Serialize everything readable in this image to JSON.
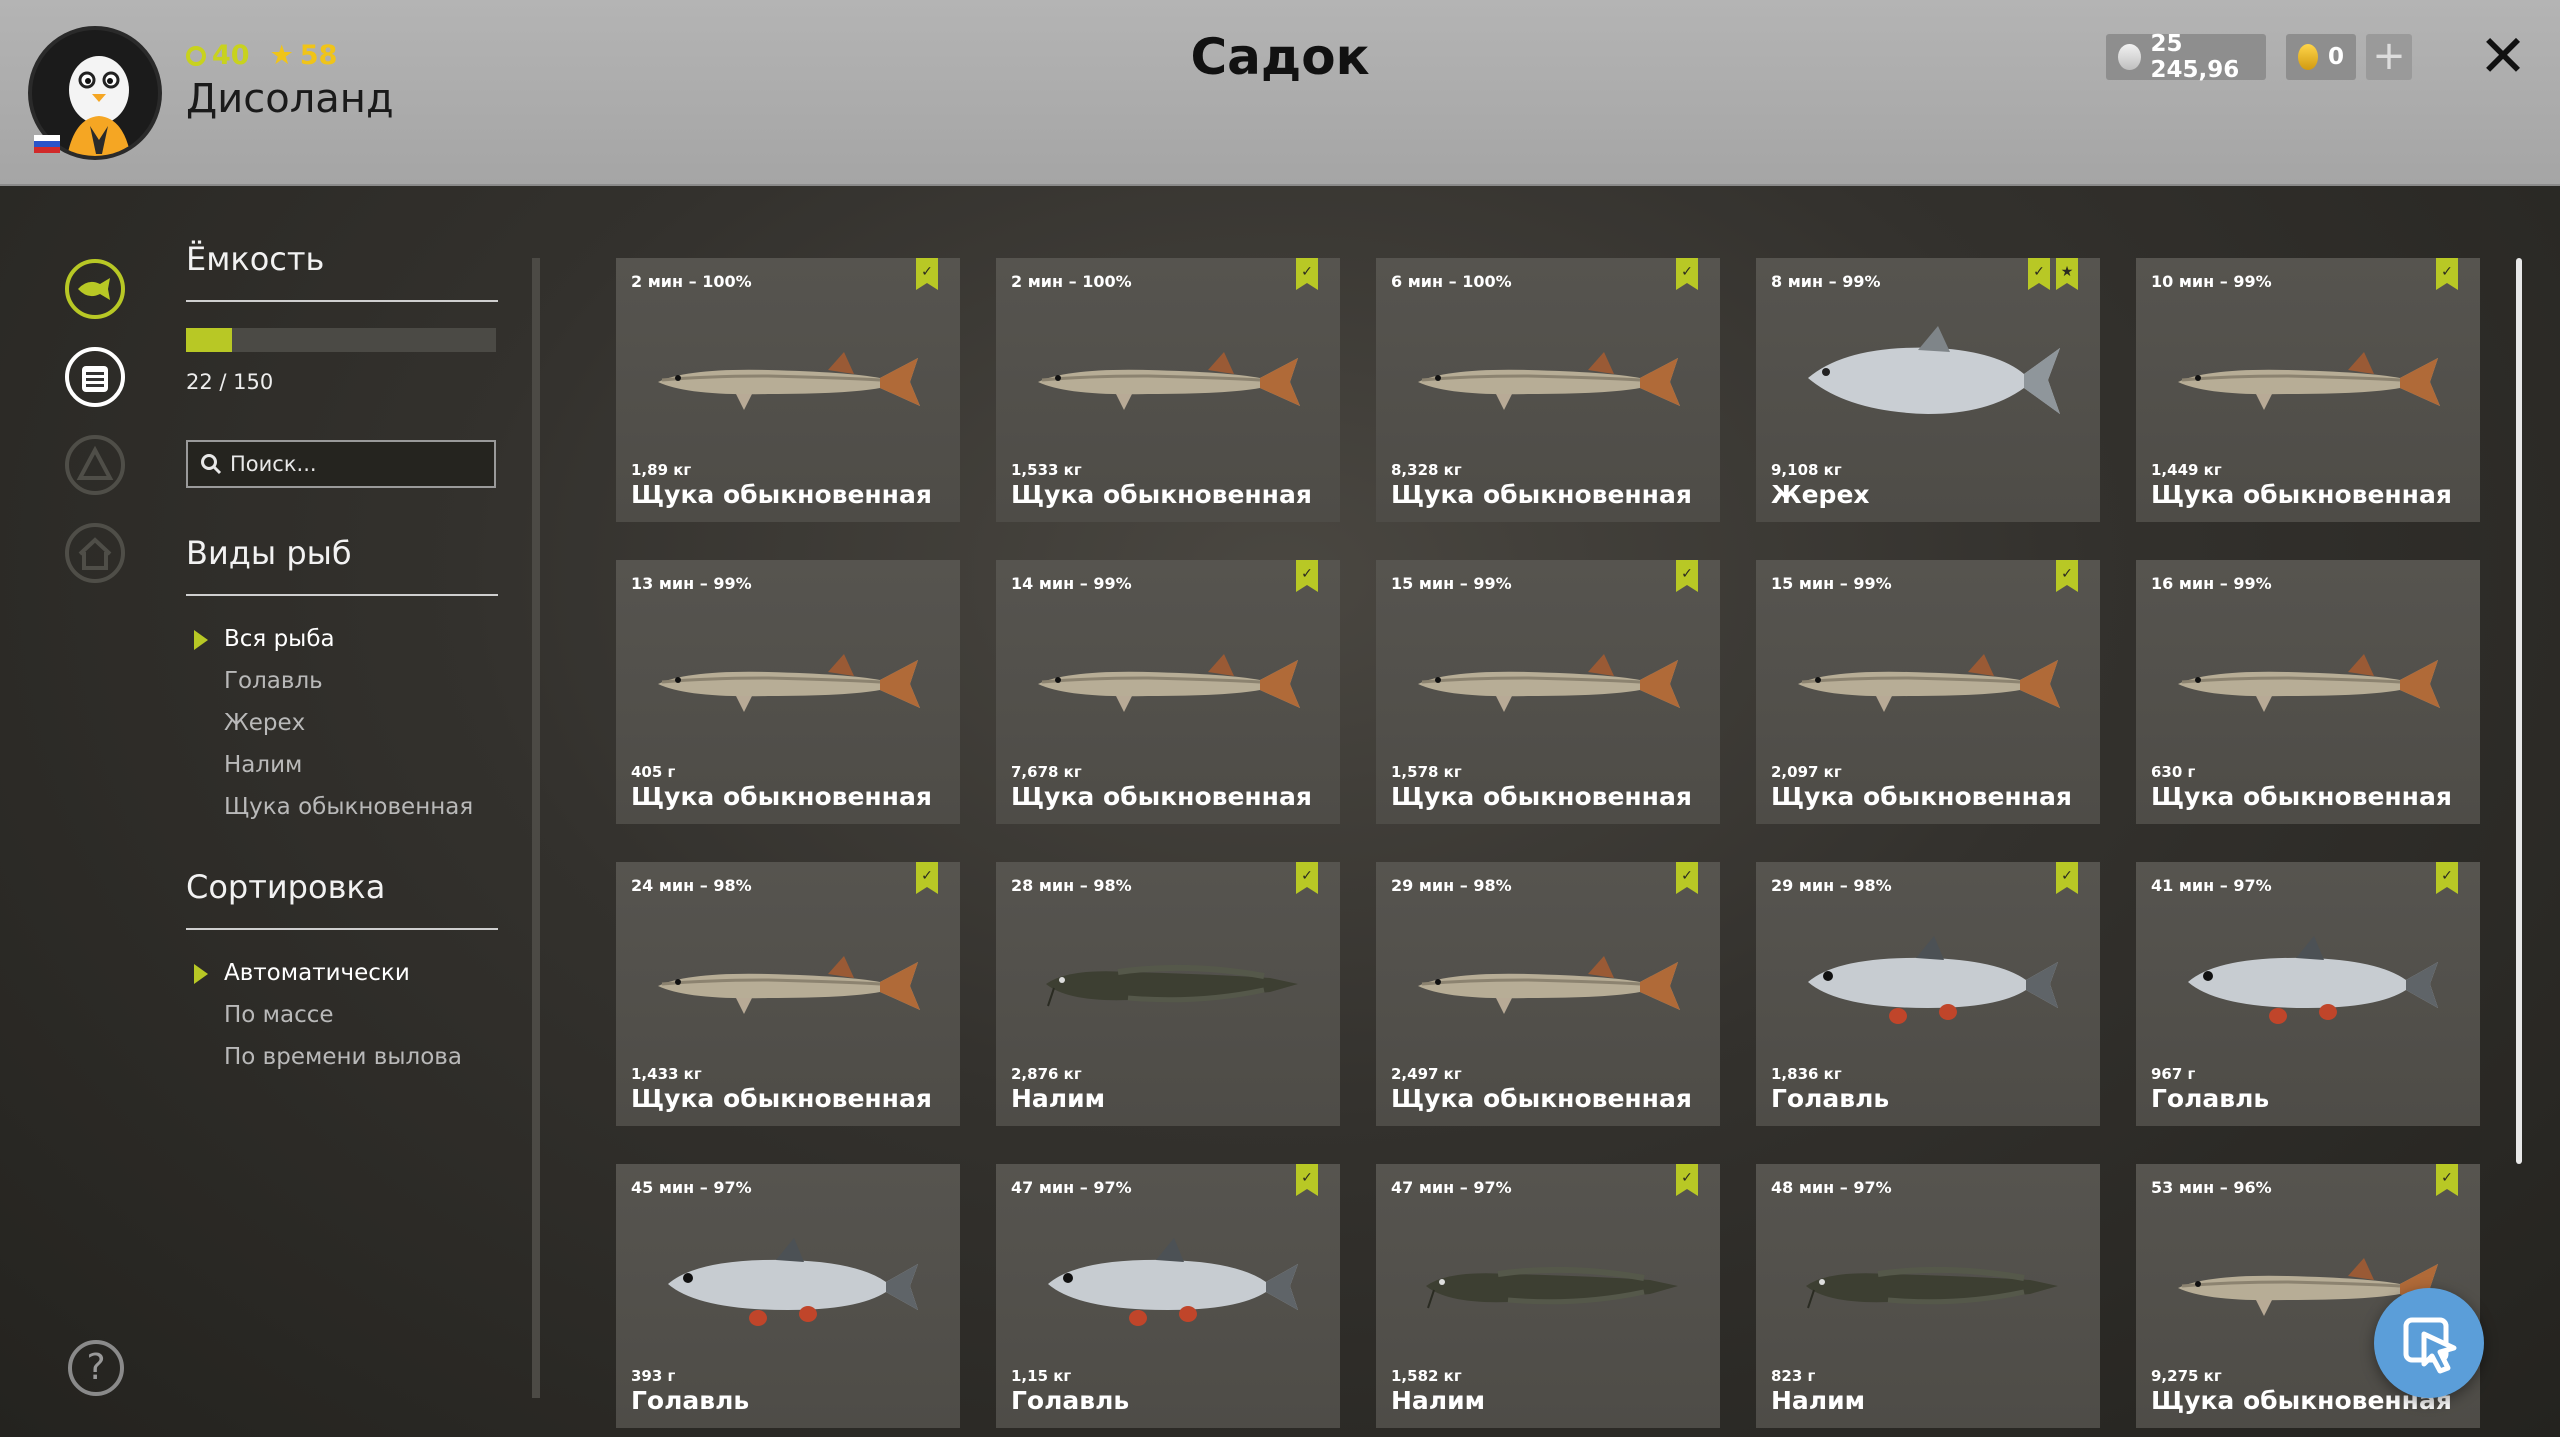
{
  "header": {
    "title": "Садок",
    "player": {
      "name": "Дисоланд",
      "level": "40",
      "stars": "58"
    },
    "silver": "25 245,96",
    "gold": "0",
    "plus_label": "+",
    "close_label": "✕"
  },
  "sidebar": {
    "capacity_title": "Ёмкость",
    "capacity_text": "22 / 150",
    "capacity_fraction": 0.147,
    "search_placeholder": "Поиск...",
    "species_title": "Виды рыб",
    "species": [
      "Вся рыба",
      "Голавль",
      "Жерех",
      "Налим",
      "Щука обыкновенная"
    ],
    "sort_title": "Сортировка",
    "sort": [
      "Автоматически",
      "По массе",
      "По времени вылова"
    ],
    "help_label": "?"
  },
  "colors": {
    "accent": "#b8c825",
    "header_bg": "#b4b4b4",
    "card_bg": "#53514c",
    "cursor_button": "#5b9ed9"
  },
  "fish": [
    {
      "time": "2 мин – 100%",
      "weight": "1,89 кг",
      "name": "Щука обыкновенная",
      "kind": "pike",
      "badges": 1,
      "star": false
    },
    {
      "time": "2 мин – 100%",
      "weight": "1,533 кг",
      "name": "Щука обыкновенная",
      "kind": "pike",
      "badges": 1,
      "star": false
    },
    {
      "time": "6 мин – 100%",
      "weight": "8,328 кг",
      "name": "Щука обыкновенная",
      "kind": "pike",
      "badges": 1,
      "star": false
    },
    {
      "time": "8 мин – 99%",
      "weight": "9,108 кг",
      "name": "Жерех",
      "kind": "asp",
      "badges": 1,
      "star": true
    },
    {
      "time": "10 мин – 99%",
      "weight": "1,449 кг",
      "name": "Щука обыкновенная",
      "kind": "pike",
      "badges": 1,
      "star": false
    },
    {
      "time": "13 мин – 99%",
      "weight": "405 г",
      "name": "Щука обыкновенная",
      "kind": "pike",
      "badges": 0,
      "star": false
    },
    {
      "time": "14 мин – 99%",
      "weight": "7,678 кг",
      "name": "Щука обыкновенная",
      "kind": "pike",
      "badges": 1,
      "star": false
    },
    {
      "time": "15 мин – 99%",
      "weight": "1,578 кг",
      "name": "Щука обыкновенная",
      "kind": "pike",
      "badges": 1,
      "star": false
    },
    {
      "time": "15 мин – 99%",
      "weight": "2,097 кг",
      "name": "Щука обыкновенная",
      "kind": "pike",
      "badges": 1,
      "star": false
    },
    {
      "time": "16 мин – 99%",
      "weight": "630 г",
      "name": "Щука обыкновенная",
      "kind": "pike",
      "badges": 0,
      "star": false
    },
    {
      "time": "24 мин – 98%",
      "weight": "1,433 кг",
      "name": "Щука обыкновенная",
      "kind": "pike",
      "badges": 1,
      "star": false
    },
    {
      "time": "28 мин – 98%",
      "weight": "2,876 кг",
      "name": "Налим",
      "kind": "burbot",
      "badges": 1,
      "star": false
    },
    {
      "time": "29 мин – 98%",
      "weight": "2,497 кг",
      "name": "Щука обыкновенная",
      "kind": "pike",
      "badges": 1,
      "star": false
    },
    {
      "time": "29 мин – 98%",
      "weight": "1,836 кг",
      "name": "Голавль",
      "kind": "chub",
      "badges": 1,
      "star": false
    },
    {
      "time": "41 мин – 97%",
      "weight": "967 г",
      "name": "Голавль",
      "kind": "chub",
      "badges": 1,
      "star": false
    },
    {
      "time": "45 мин – 97%",
      "weight": "393 г",
      "name": "Голавль",
      "kind": "chub",
      "badges": 0,
      "star": false
    },
    {
      "time": "47 мин – 97%",
      "weight": "1,15 кг",
      "name": "Голавль",
      "kind": "chub",
      "badges": 1,
      "star": false
    },
    {
      "time": "47 мин – 97%",
      "weight": "1,582 кг",
      "name": "Налим",
      "kind": "burbot",
      "badges": 1,
      "star": false
    },
    {
      "time": "48 мин – 97%",
      "weight": "823 г",
      "name": "Налим",
      "kind": "burbot",
      "badges": 0,
      "star": false
    },
    {
      "time": "53 мин – 96%",
      "weight": "9,275 кг",
      "name": "Щука обыкновенная",
      "kind": "pike",
      "badges": 1,
      "star": false
    }
  ]
}
